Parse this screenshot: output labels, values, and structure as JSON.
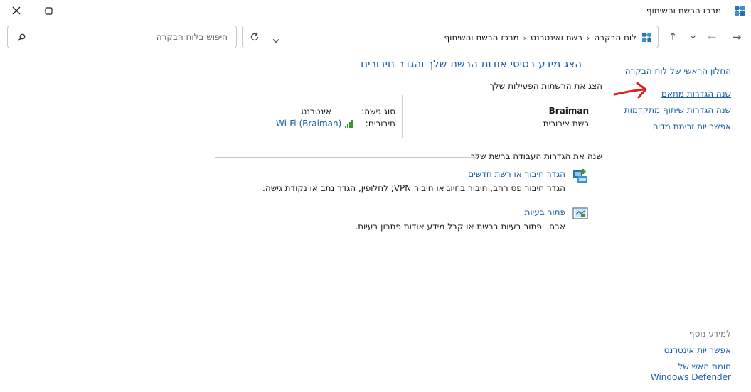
{
  "window": {
    "title": "מרכז הרשת והשיתוף"
  },
  "address_bar": {
    "crumbs": [
      "לוח הבקרה",
      "רשת ואינטרנט",
      "מרכז הרשת והשיתוף"
    ]
  },
  "search": {
    "placeholder": "חיפוש בלוח הבקרה"
  },
  "sidebar": {
    "home_link": "החלון הראשי של לוח הבקרה",
    "links": [
      "שנה הגדרות מתאם",
      "שנה הגדרות שיתוף מתקדמות",
      "אפשרויות זרימת מדיה"
    ],
    "see_also_header": "למידע נוסף",
    "see_also_links": [
      "אפשרויות אינטרנט",
      "חומת האש של Windows Defender"
    ]
  },
  "main": {
    "heading": "הצג מידע בסיסי אודות הרשת שלך והגדר חיבורים",
    "active_networks_header": "הצג את הרשתות הפעילות שלך",
    "network": {
      "name": "Braiman",
      "type": "רשת ציבורית",
      "access_type_label": "סוג גישה:",
      "access_type_value": "אינטרנט",
      "connections_label": "חיבורים:",
      "connection_value": "Wi-Fi (Braiman)"
    },
    "change_settings_header": "שנה את הגדרות העבודה ברשת שלך",
    "tasks": [
      {
        "title": "הגדר חיבור או רשת חדשים",
        "description": "הגדר חיבור פס רחב, חיבור בחיוג או חיבור VPN; לחלופין, הגדר נתב או נקודת גישה."
      },
      {
        "title": "פתור בעיות",
        "description": "אבחן ופתור בעיות ברשת או קבל מידע אודות פתרון בעיות."
      }
    ]
  },
  "colors": {
    "link": "#1a5ea8",
    "heading": "#1a5ea8",
    "annotation_arrow": "#e0201c"
  }
}
